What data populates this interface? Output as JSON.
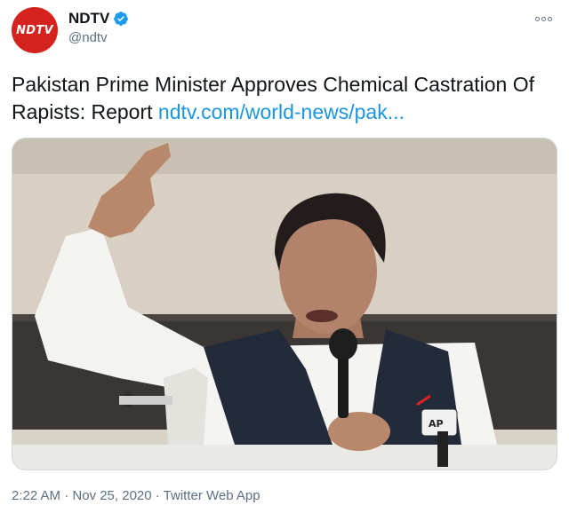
{
  "account": {
    "avatar_text": "NDTV",
    "display_name": "NDTV",
    "handle": "@ndtv",
    "verified": true
  },
  "tweet": {
    "text": "Pakistan Prime Minister Approves Chemical Castration Of Rapists: Report ",
    "link_text": "ndtv.com/world-news/pak...",
    "timestamp": "2:22 AM · Nov 25, 2020 · Twitter Web App"
  },
  "media": {
    "description": "Photo of a speaker in white kurta and dark vest with raised hand at a microphone",
    "mic_label": "AP"
  },
  "colors": {
    "brand": "#d6221e",
    "link": "#1b95e0",
    "verified": "#1d9bf0",
    "secondary_text": "#5b7083"
  },
  "icons": {
    "more": "more-options-icon",
    "verified": "verified-badge-icon"
  }
}
